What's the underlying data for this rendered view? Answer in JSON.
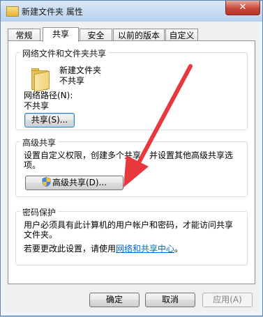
{
  "window": {
    "title": "新建文件夹 属性",
    "close_symbol": "✕"
  },
  "tabs": [
    {
      "label": "常规",
      "active": false
    },
    {
      "label": "共享",
      "active": true
    },
    {
      "label": "安全",
      "active": false
    },
    {
      "label": "以前的版本",
      "active": false
    },
    {
      "label": "自定义",
      "active": false
    }
  ],
  "network_sharing": {
    "legend": "网络文件和文件夹共享",
    "folder_name": "新建文件夹",
    "folder_status": "不共享",
    "path_label": "网络路径(N):",
    "path_value": "不共享",
    "share_button": "共享(S)..."
  },
  "advanced_sharing": {
    "legend": "高级共享",
    "description_line1": "设置自定义权限，创建多个共享，并设置其他高级共享选",
    "description_line2": "项。",
    "button": "高级共享(D)..."
  },
  "password": {
    "legend": "密码保护",
    "line1": "用户必须具有此计算机的用户帐户和密码，才能访问共享",
    "line2": "文件夹。",
    "change_prefix": "若要更改此设置，请使用",
    "link": "网络和共享中心",
    "change_suffix": "。"
  },
  "footer": {
    "ok": "确定",
    "cancel": "取消",
    "apply": "应用(A)"
  },
  "annotation": {
    "arrow_color": "#e8383d"
  }
}
